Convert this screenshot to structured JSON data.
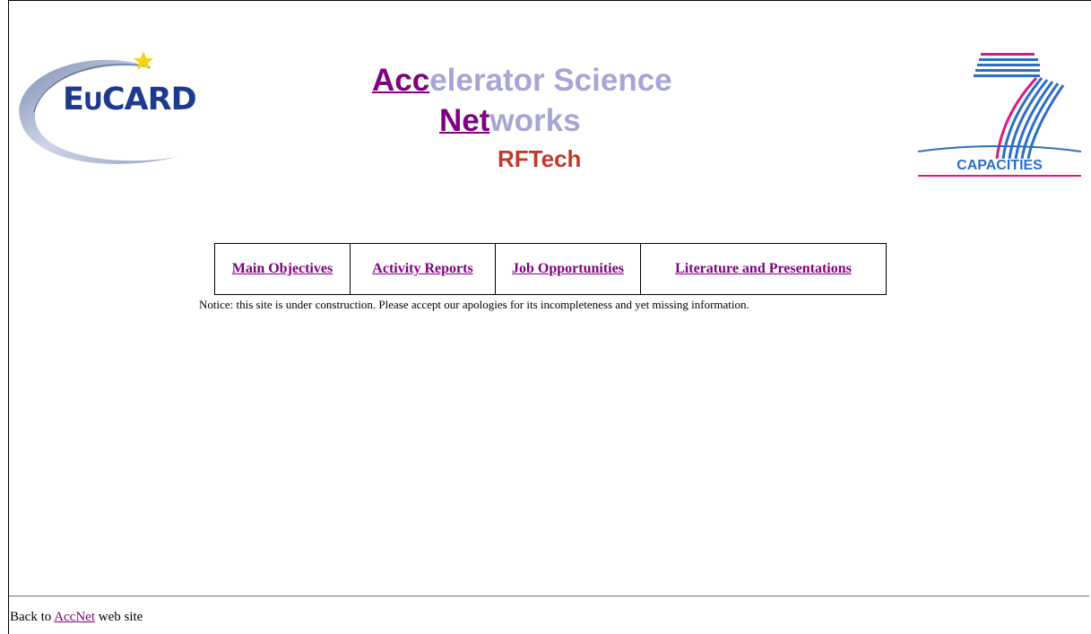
{
  "logos": {
    "left": {
      "name": "EuCARD",
      "text_main": "E",
      "text_small_u": "U",
      "text_rest": "CARD",
      "color": "#1d3a8f",
      "star_color": "#f5d20a"
    },
    "right": {
      "name": "FP7 Capacities",
      "text": "CAPACITIES",
      "color_blue": "#2b6ec8",
      "color_pink": "#e0177a"
    }
  },
  "title": {
    "line1_accent": "Acc",
    "line1_rest": "elerator Science",
    "line2_accent": "Net",
    "line2_rest": "works",
    "line3": "RFTech",
    "accent_color": "#800080",
    "light_color": "#a7a4d6",
    "sub_color": "#c0392b"
  },
  "nav": {
    "items": [
      {
        "label": "Main Objectives"
      },
      {
        "label": "Activity Reports"
      },
      {
        "label": "Job Opportunities"
      },
      {
        "label": "Literature and Presentations"
      }
    ],
    "link_color": "#800080"
  },
  "notice": "Notice: this site is under construction. Please accept our apologies for its incompleteness and yet missing information.",
  "footer": {
    "prefix": "Back to",
    "link": "AccNet",
    "suffix": "web site"
  }
}
